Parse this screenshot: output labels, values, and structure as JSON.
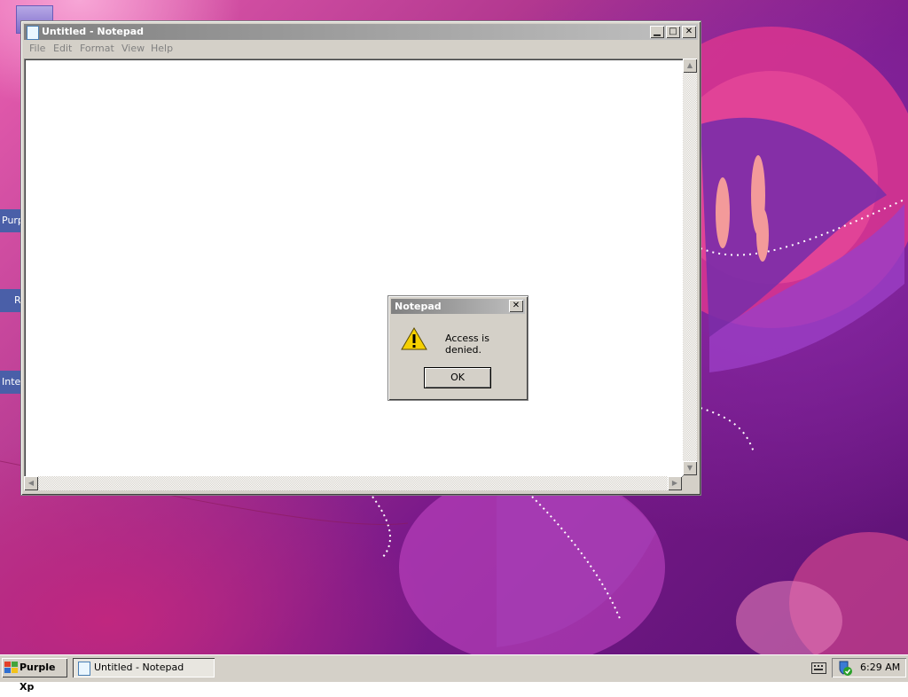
{
  "desktop": {
    "icons": [
      {
        "label": "Purp",
        "name": "desktop-icon-purple"
      },
      {
        "label": "R",
        "name": "desktop-icon-r"
      },
      {
        "label": "Inte",
        "name": "desktop-icon-internet"
      }
    ],
    "colors": {
      "accent": "#b1378f",
      "deep": "#5b1275"
    }
  },
  "notepad": {
    "title": "Untitled - Notepad",
    "menu": [
      "File",
      "Edit",
      "Format",
      "View",
      "Help"
    ],
    "content": ""
  },
  "dialog": {
    "title": "Notepad",
    "message": "Access is denied.",
    "icon": "warning-icon",
    "ok_label": "OK"
  },
  "taskbar": {
    "start_label": "Purple Xp",
    "tasks": [
      {
        "label": "Untitled - Notepad",
        "active": true
      }
    ],
    "clock": "6:29 AM",
    "tray_icons": [
      "keyboard-icon",
      "security-shield-icon"
    ]
  }
}
